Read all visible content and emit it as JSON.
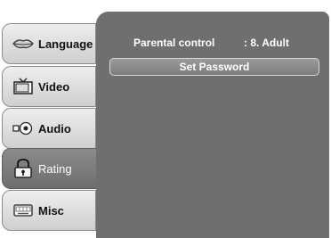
{
  "menu": {
    "tabs": [
      {
        "label": "Language",
        "icon": "lips-icon",
        "active": false
      },
      {
        "label": "Video",
        "icon": "tv-icon",
        "active": false
      },
      {
        "label": "Audio",
        "icon": "speaker-icon",
        "active": false
      },
      {
        "label": "Rating",
        "icon": "lock-icon",
        "active": true
      },
      {
        "label": "Misc",
        "icon": "keyboard-icon",
        "active": false
      }
    ]
  },
  "rating_panel": {
    "parental_control_label": "Parental control",
    "parental_control_value": ": 8. Adult",
    "set_password_label": "Set Password"
  },
  "colors": {
    "panel_bg": "#6f6f6f",
    "active_tab": "#7a7a7a",
    "inactive_tab": "#e0e0e0"
  }
}
